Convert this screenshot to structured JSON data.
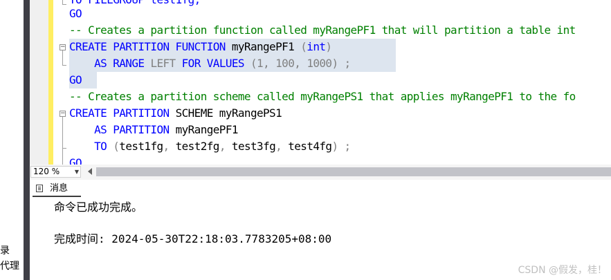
{
  "left_panel": {
    "line1": "录",
    "line2": "代理"
  },
  "editor": {
    "line_0": "TO FILEGROUP test1fg,",
    "line_1": "GO",
    "line_2": "-- Creates a partition function called myRangePF1 that will partition a table int",
    "line_3": [
      {
        "t": "CREATE PARTITION FUNCTION",
        "c": "kw"
      },
      {
        "t": " myRangePF1 ",
        "c": ""
      },
      {
        "t": "(",
        "c": "gy"
      },
      {
        "t": "int",
        "c": "kw"
      },
      {
        "t": ")",
        "c": "gy"
      }
    ],
    "line_4": [
      {
        "t": "    ",
        "c": ""
      },
      {
        "t": "AS RANGE",
        "c": "kw"
      },
      {
        "t": " ",
        "c": ""
      },
      {
        "t": "LEFT",
        "c": "gy"
      },
      {
        "t": " ",
        "c": ""
      },
      {
        "t": "FOR VALUES",
        "c": "kw"
      },
      {
        "t": " (1, 100, 1000) ;",
        "c": "gy"
      }
    ],
    "line_5": "GO",
    "line_6": "-- Creates a partition scheme called myRangePS1 that applies myRangePF1 to the fo",
    "line_7": [
      {
        "t": "CREATE PARTITION",
        "c": "kw"
      },
      {
        "t": " SCHEME myRangePS1",
        "c": ""
      }
    ],
    "line_8": [
      {
        "t": "    ",
        "c": ""
      },
      {
        "t": "AS PARTITION",
        "c": "kw"
      },
      {
        "t": " myRangePF1",
        "c": ""
      }
    ],
    "line_9": [
      {
        "t": "    ",
        "c": ""
      },
      {
        "t": "TO",
        "c": "kw"
      },
      {
        "t": " (",
        "c": "gy"
      },
      {
        "t": "test1fg",
        "c": ""
      },
      {
        "t": ", ",
        "c": "gy"
      },
      {
        "t": "test2fg",
        "c": ""
      },
      {
        "t": ", ",
        "c": "gy"
      },
      {
        "t": "test3fg",
        "c": ""
      },
      {
        "t": ", ",
        "c": "gy"
      },
      {
        "t": "test4fg",
        "c": ""
      },
      {
        "t": ") ;",
        "c": "gy"
      }
    ],
    "line_10": "GO"
  },
  "status_bar": {
    "zoom": "120 %"
  },
  "messages": {
    "tab_label": "消息",
    "line1": "命令已成功完成。",
    "line2": "完成时间: 2024-05-30T22:18:03.7783205+08:00"
  },
  "watermark": "CSDN @假发，桂！",
  "colors": {
    "keyword": "#0000ff",
    "comment": "#008000",
    "operator": "#808080",
    "highlight": "#dde5ef",
    "change_margin": "#ffee62"
  }
}
